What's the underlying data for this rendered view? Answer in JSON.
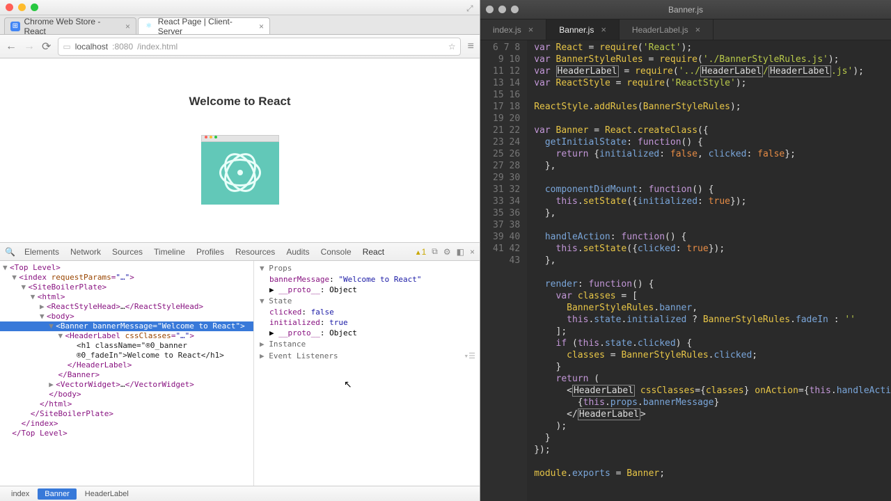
{
  "browser": {
    "tabs": [
      {
        "label": "Chrome Web Store - React"
      },
      {
        "label": "React Page | Client-Server"
      }
    ],
    "url_host": "localhost",
    "url_port": ":8080",
    "url_path": "/index.html"
  },
  "page": {
    "heading": "Welcome to React"
  },
  "devtools": {
    "panels": [
      "Elements",
      "Network",
      "Sources",
      "Timeline",
      "Profiles",
      "Resources",
      "Audits",
      "Console",
      "React"
    ],
    "active_panel": "React",
    "warning_count": "1",
    "crumbs": [
      "index",
      "Banner",
      "HeaderLabel"
    ],
    "active_crumb": "Banner",
    "tree": [
      {
        "i": 0,
        "tri": "▼",
        "tag": "Top Level"
      },
      {
        "i": 1,
        "tri": "▼",
        "tag": "index",
        "attr": "requestParams",
        "val": "\"…\""
      },
      {
        "i": 2,
        "tri": "▼",
        "tag": "SiteBoilerPlate"
      },
      {
        "i": 3,
        "tri": "▼",
        "tag": "html"
      },
      {
        "i": 4,
        "tri": "▶",
        "tag": "ReactStyleHead",
        "txt": "…",
        "close": "ReactStyleHead"
      },
      {
        "i": 4,
        "tri": "▼",
        "tag": "body"
      },
      {
        "i": 5,
        "tri": "▼",
        "tag": "Banner",
        "attr": "bannerMessage",
        "val": "\"Welcome to React\"",
        "sel": true
      },
      {
        "i": 6,
        "tri": "▼",
        "tag": "HeaderLabel",
        "attr": "cssClasses",
        "val": "\"…\""
      },
      {
        "i": 7,
        "raw": "<h1 className=\"®0_banner"
      },
      {
        "i": 7,
        "raw": "®0_fadeIn\">Welcome to React</h1>"
      },
      {
        "i": 6,
        "close_only": "HeaderLabel"
      },
      {
        "i": 5,
        "close_only": "Banner"
      },
      {
        "i": 5,
        "tri": "▶",
        "tag": "VectorWidget",
        "txt": "…",
        "close": "VectorWidget"
      },
      {
        "i": 4,
        "close_only": "body"
      },
      {
        "i": 3,
        "close_only": "html"
      },
      {
        "i": 2,
        "close_only": "SiteBoilerPlate"
      },
      {
        "i": 1,
        "close_only": "index"
      },
      {
        "i": 0,
        "close_only": "Top Level"
      }
    ],
    "side": {
      "props_label": "Props",
      "props": [
        {
          "k": "bannerMessage",
          "v": "\"Welcome to React\""
        },
        {
          "k": "__proto__",
          "v": "Object",
          "proto": true
        }
      ],
      "state_label": "State",
      "state": [
        {
          "k": "clicked",
          "v": "false"
        },
        {
          "k": "initialized",
          "v": "true"
        },
        {
          "k": "__proto__",
          "v": "Object",
          "proto": true
        }
      ],
      "instance_label": "Instance",
      "listeners_label": "Event Listeners"
    }
  },
  "editor": {
    "title": "Banner.js",
    "tabs": [
      {
        "label": "index.js"
      },
      {
        "label": "Banner.js",
        "on": true
      },
      {
        "label": "HeaderLabel.js"
      }
    ],
    "first_line": 6,
    "code": [
      [
        [
          "kw",
          "var "
        ],
        [
          "def",
          "React"
        ],
        [
          "op",
          " = "
        ],
        [
          "fn",
          "require"
        ],
        [
          "op",
          "("
        ],
        [
          "str",
          "'React'"
        ],
        [
          "op",
          ");"
        ]
      ],
      [
        [
          "kw",
          "var "
        ],
        [
          "def",
          "BannerStyleRules"
        ],
        [
          "op",
          " = "
        ],
        [
          "fn",
          "require"
        ],
        [
          "op",
          "("
        ],
        [
          "str",
          "'./BannerStyleRules.js'"
        ],
        [
          "op",
          ");"
        ]
      ],
      [
        [
          "kw",
          "var "
        ],
        [
          "box",
          "HeaderLabel"
        ],
        [
          "op",
          " = "
        ],
        [
          "fn",
          "require"
        ],
        [
          "op",
          "("
        ],
        [
          "str",
          "'../"
        ],
        [
          "box",
          "HeaderLabel"
        ],
        [
          "str",
          "/"
        ],
        [
          "box",
          "HeaderLabel"
        ],
        [
          "str",
          ".js'"
        ],
        [
          "op",
          ");"
        ]
      ],
      [
        [
          "kw",
          "var "
        ],
        [
          "def",
          "ReactStyle"
        ],
        [
          "op",
          " = "
        ],
        [
          "fn",
          "require"
        ],
        [
          "op",
          "("
        ],
        [
          "str",
          "'ReactStyle'"
        ],
        [
          "op",
          ");"
        ]
      ],
      [],
      [
        [
          "def",
          "ReactStyle"
        ],
        [
          "op",
          "."
        ],
        [
          "fn",
          "addRules"
        ],
        [
          "op",
          "("
        ],
        [
          "def",
          "BannerStyleRules"
        ],
        [
          "op",
          ");"
        ]
      ],
      [],
      [
        [
          "kw",
          "var "
        ],
        [
          "def",
          "Banner"
        ],
        [
          "op",
          " = "
        ],
        [
          "def",
          "React"
        ],
        [
          "op",
          "."
        ],
        [
          "fn",
          "createClass"
        ],
        [
          "op",
          "({"
        ]
      ],
      [
        [
          "op",
          "  "
        ],
        [
          "prop",
          "getInitialState"
        ],
        [
          "op",
          ": "
        ],
        [
          "kw",
          "function"
        ],
        [
          "op",
          "() {"
        ]
      ],
      [
        [
          "op",
          "    "
        ],
        [
          "kw",
          "return"
        ],
        [
          "op",
          " {"
        ],
        [
          "prop",
          "initialized"
        ],
        [
          "op",
          ": "
        ],
        [
          "bool",
          "false"
        ],
        [
          "op",
          ", "
        ],
        [
          "prop",
          "clicked"
        ],
        [
          "op",
          ": "
        ],
        [
          "bool",
          "false"
        ],
        [
          "op",
          "};"
        ]
      ],
      [
        [
          "op",
          "  },"
        ]
      ],
      [],
      [
        [
          "op",
          "  "
        ],
        [
          "prop",
          "componentDidMount"
        ],
        [
          "op",
          ": "
        ],
        [
          "kw",
          "function"
        ],
        [
          "op",
          "() {"
        ]
      ],
      [
        [
          "op",
          "    "
        ],
        [
          "this",
          "this"
        ],
        [
          "op",
          "."
        ],
        [
          "fn",
          "setState"
        ],
        [
          "op",
          "({"
        ],
        [
          "prop",
          "initialized"
        ],
        [
          "op",
          ": "
        ],
        [
          "bool",
          "true"
        ],
        [
          "op",
          "});"
        ]
      ],
      [
        [
          "op",
          "  },"
        ]
      ],
      [],
      [
        [
          "op",
          "  "
        ],
        [
          "prop",
          "handleAction"
        ],
        [
          "op",
          ": "
        ],
        [
          "kw",
          "function"
        ],
        [
          "op",
          "() {"
        ]
      ],
      [
        [
          "op",
          "    "
        ],
        [
          "this",
          "this"
        ],
        [
          "op",
          "."
        ],
        [
          "fn",
          "setState"
        ],
        [
          "op",
          "({"
        ],
        [
          "prop",
          "clicked"
        ],
        [
          "op",
          ": "
        ],
        [
          "bool",
          "true"
        ],
        [
          "op",
          "});"
        ]
      ],
      [
        [
          "op",
          "  },"
        ]
      ],
      [],
      [
        [
          "op",
          "  "
        ],
        [
          "prop",
          "render"
        ],
        [
          "op",
          ": "
        ],
        [
          "kw",
          "function"
        ],
        [
          "op",
          "() {"
        ]
      ],
      [
        [
          "op",
          "    "
        ],
        [
          "kw",
          "var"
        ],
        [
          "op",
          " "
        ],
        [
          "def",
          "classes"
        ],
        [
          "op",
          " = ["
        ]
      ],
      [
        [
          "op",
          "      "
        ],
        [
          "def",
          "BannerStyleRules"
        ],
        [
          "op",
          "."
        ],
        [
          "prop",
          "banner"
        ],
        [
          "op",
          ","
        ]
      ],
      [
        [
          "op",
          "      "
        ],
        [
          "this",
          "this"
        ],
        [
          "op",
          "."
        ],
        [
          "prop",
          "state"
        ],
        [
          "op",
          "."
        ],
        [
          "prop",
          "initialized"
        ],
        [
          "op",
          " ? "
        ],
        [
          "def",
          "BannerStyleRules"
        ],
        [
          "op",
          "."
        ],
        [
          "prop",
          "fadeIn"
        ],
        [
          "op",
          " : "
        ],
        [
          "str",
          "''"
        ]
      ],
      [
        [
          "op",
          "    ];"
        ]
      ],
      [
        [
          "op",
          "    "
        ],
        [
          "kw",
          "if"
        ],
        [
          "op",
          " ("
        ],
        [
          "this",
          "this"
        ],
        [
          "op",
          "."
        ],
        [
          "prop",
          "state"
        ],
        [
          "op",
          "."
        ],
        [
          "prop",
          "clicked"
        ],
        [
          "op",
          ") {"
        ]
      ],
      [
        [
          "op",
          "      "
        ],
        [
          "def",
          "classes"
        ],
        [
          "op",
          " = "
        ],
        [
          "def",
          "BannerStyleRules"
        ],
        [
          "op",
          "."
        ],
        [
          "prop",
          "clicked"
        ],
        [
          "op",
          ";"
        ]
      ],
      [
        [
          "op",
          "    }"
        ]
      ],
      [
        [
          "op",
          "    "
        ],
        [
          "kw",
          "return"
        ],
        [
          "op",
          " ("
        ]
      ],
      [
        [
          "op",
          "      <"
        ],
        [
          "box",
          "HeaderLabel"
        ],
        [
          "op",
          " "
        ],
        [
          "attr2",
          "cssClasses"
        ],
        [
          "op",
          "={"
        ],
        [
          "def",
          "classes"
        ],
        [
          "op",
          "} "
        ],
        [
          "attr2",
          "onAction"
        ],
        [
          "op",
          "={"
        ],
        [
          "this",
          "this"
        ],
        [
          "op",
          "."
        ],
        [
          "prop",
          "handleActi"
        ]
      ],
      [
        [
          "op",
          "        {"
        ],
        [
          "this",
          "this"
        ],
        [
          "op",
          "."
        ],
        [
          "prop",
          "props"
        ],
        [
          "op",
          "."
        ],
        [
          "prop",
          "bannerMessage"
        ],
        [
          "op",
          "}"
        ]
      ],
      [
        [
          "op",
          "      </"
        ],
        [
          "box",
          "HeaderLabel"
        ],
        [
          "op",
          ">"
        ]
      ],
      [
        [
          "op",
          "    );"
        ]
      ],
      [
        [
          "op",
          "  }"
        ]
      ],
      [
        [
          "op",
          "});"
        ]
      ],
      [],
      [
        [
          "def",
          "module"
        ],
        [
          "op",
          "."
        ],
        [
          "prop",
          "exports"
        ],
        [
          "op",
          " = "
        ],
        [
          "def",
          "Banner"
        ],
        [
          "op",
          ";"
        ]
      ],
      []
    ]
  }
}
